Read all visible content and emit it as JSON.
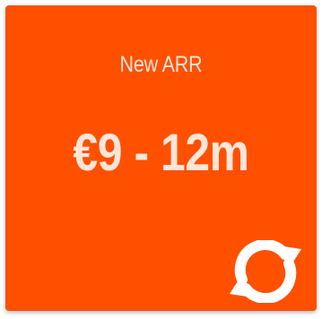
{
  "card": {
    "label": "New ARR",
    "value": "€9 - 12m",
    "icon": "refresh-icon",
    "colors": {
      "background": "#ff5000",
      "text": "#ffe6d9",
      "icon": "#ffffff"
    }
  }
}
